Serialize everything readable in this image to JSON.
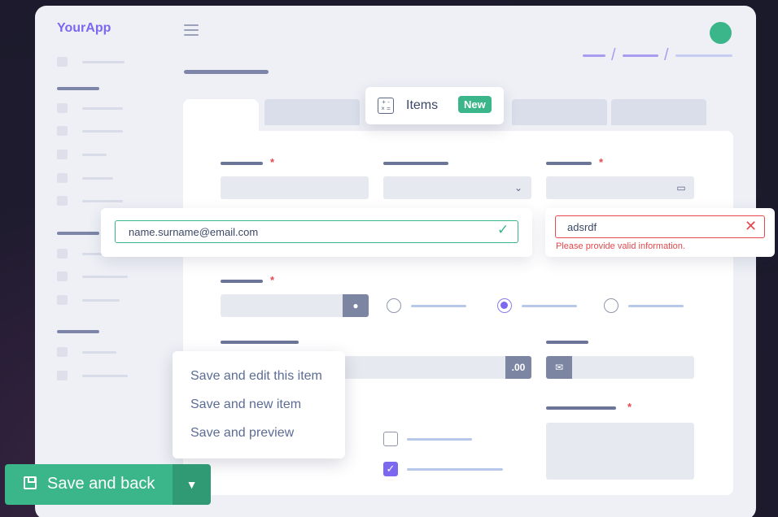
{
  "app": {
    "brand": "YourApp"
  },
  "tabs": {
    "items_label": "Items",
    "items_badge": "New"
  },
  "email_field": {
    "value": "name.surname@email.com",
    "status": "valid"
  },
  "error_field": {
    "value": "adsrdf",
    "error_message": "Please provide valid information."
  },
  "currency_field": {
    "suffix": ".00"
  },
  "save_menu": {
    "items": [
      "Save and edit this item",
      "Save and new item",
      "Save and preview"
    ]
  },
  "save_button": {
    "label": "Save and back"
  },
  "colors": {
    "accent": "#7b68ee",
    "success": "#3bb58a",
    "danger": "#e5484d"
  },
  "icons": [
    "hamburger-icon",
    "calculator-icon",
    "check-icon",
    "close-icon",
    "chevron-down-icon",
    "calendar-icon",
    "user-icon",
    "email-icon",
    "floppy-icon",
    "caret-down-icon"
  ]
}
